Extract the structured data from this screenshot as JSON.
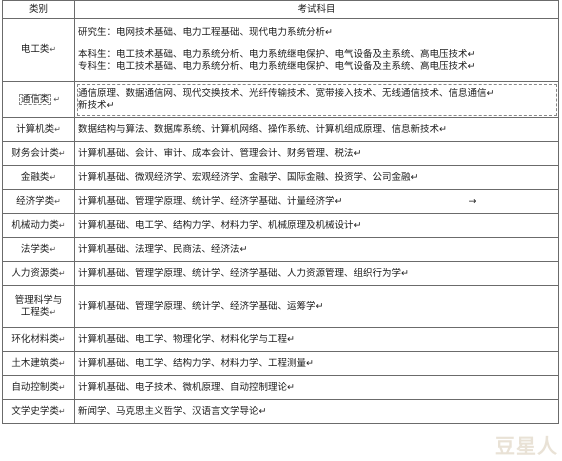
{
  "header": {
    "category": "类别",
    "subjects": "考试科目"
  },
  "rows": [
    {
      "category": "电工类",
      "lines": [
        "研究生：电网技术基础、电力工程基础、现代电力系统分析↵",
        "",
        "本科生：电工技术基础、电力系统分析、电力系统继电保护、电气设备及主系统、高电压技术↵",
        "专科生：电工技术基础、电力系统分析、电力系统继电保护、电气设备及主系统、高电压技术↵"
      ]
    },
    {
      "category": "通信类",
      "lines": [
        "通信原理、数据通信网、现代交换技术、光纤传输技术、宽带接入技术、无线通信技术、信息通信↵",
        "新技术↵"
      ]
    },
    {
      "category": "计算机类",
      "lines": [
        "数据结构与算法、数据库系统、计算机网络、操作系统、计算机组成原理、信息新技术↵"
      ]
    },
    {
      "category": "财务会计类",
      "lines": [
        "计算机基础、会计、审计、成本会计、管理会计、财务管理、税法↵"
      ]
    },
    {
      "category": "金融类",
      "lines": [
        "计算机基础、微观经济学、宏观经济学、金融学、国际金融、投资学、公司金融↵"
      ]
    },
    {
      "category": "经济学类",
      "lines": [
        "计算机基础、管理学原理、统计学、经济学基础、计量经济学↵"
      ],
      "arrow": "→"
    },
    {
      "category": "机械动力类",
      "lines": [
        "计算机基础、电工学、结构力学、材料力学、机械原理及机械设计↵"
      ]
    },
    {
      "category": "法学类",
      "lines": [
        "计算机基础、法理学、民商法、经济法↵"
      ]
    },
    {
      "category": "人力资源类",
      "lines": [
        "计算机基础、管理学原理、统计学、经济学基础、人力资源管理、组织行为学↵"
      ]
    },
    {
      "category": "管理科学与工程类",
      "category_lines": [
        "管理科学与",
        "工程类"
      ],
      "lines": [
        "计算机基础、管理学原理、统计学、经济学基础、运筹学↵"
      ]
    },
    {
      "category": "环化材料类",
      "lines": [
        "计算机基础、电工学、物理化学、材料化学与工程↵"
      ]
    },
    {
      "category": "土木建筑类",
      "lines": [
        "计算机基础、电工学、结构力学、材料力学、工程测量↵"
      ]
    },
    {
      "category": "自动控制类",
      "lines": [
        "计算机基础、电子技术、微机原理、自动控制理论↵"
      ]
    },
    {
      "category": "文学史学类",
      "lines": [
        "新闻学、马克思主义哲学、汉语言文学导论↵"
      ]
    }
  ],
  "watermark": "豆星人"
}
